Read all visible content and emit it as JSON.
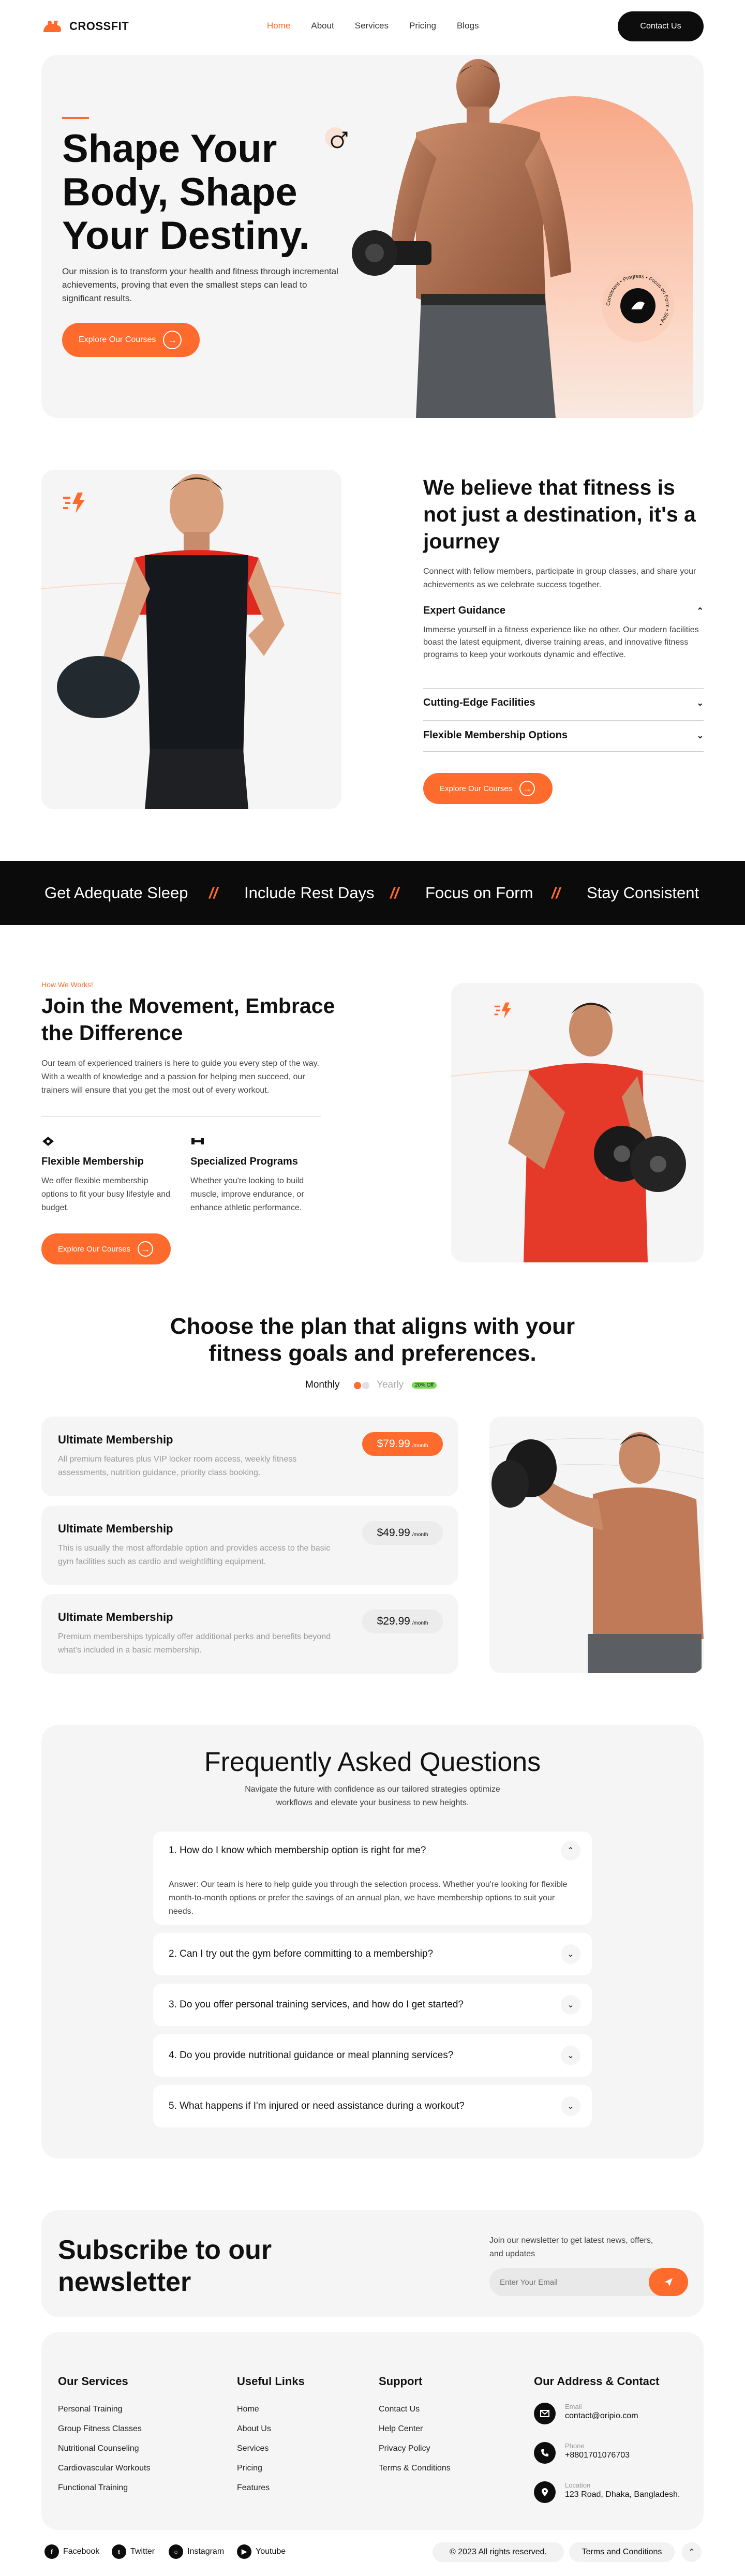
{
  "nav": {
    "brand": "CROSSFIT",
    "links": [
      "Home",
      "About",
      "Services",
      "Pricing",
      "Blogs"
    ],
    "contact_button": "Contact Us"
  },
  "hero": {
    "title": "Shape Your Body, Shape Your Destiny.",
    "description": "Our mission is to transform your health and fitness through incremental achievements, proving that even the smallest steps can lead to significant results.",
    "cta": "Explore Our Courses",
    "badge_text": "Consistent • Progress • Focus on Form • Stay •"
  },
  "about": {
    "title": "We believe that fitness is not just a destination, it's a journey",
    "subtitle": "Connect with fellow members, participate in group classes, and share your achievements as we celebrate success together.",
    "accordion": [
      {
        "title": "Expert Guidance",
        "body": "Immerse yourself in a fitness experience like no other. Our modern facilities boast the latest equipment, diverse training areas, and innovative fitness programs to keep your workouts dynamic and effective."
      },
      {
        "title": "Cutting-Edge Facilities",
        "body": ""
      },
      {
        "title": "Flexible Membership Options",
        "body": ""
      }
    ],
    "cta": "Explore Our Courses"
  },
  "banner": {
    "items": [
      "Get Adequate Sleep",
      "Include Rest Days",
      "Focus on Form",
      "Stay Consistent"
    ]
  },
  "join": {
    "eyebrow": "How We Works!",
    "title": "Join the Movement, Embrace the Difference",
    "description": "Our team of experienced trainers is here to guide you every step of the way. With a wealth of knowledge and a passion for helping men succeed, our trainers will ensure that you get the most out of every workout.",
    "features": [
      {
        "title": "Flexible Membership",
        "desc": "We offer flexible membership options to fit your busy lifestyle and budget."
      },
      {
        "title": "Specialized Programs",
        "desc": "Whether you're looking to build muscle, improve endurance, or enhance athletic performance."
      }
    ],
    "cta": "Explore Our Courses"
  },
  "plans": {
    "title": "Choose the plan that aligns with your fitness goals and preferences.",
    "toggle_monthly": "Monthly",
    "toggle_yearly": "Yearly",
    "yearly_badge": "20% Off",
    "items": [
      {
        "name": "Ultimate Membership",
        "desc": "All premium features plus VIP locker room access, weekly fitness assessments, nutrition guidance, priority class booking.",
        "price": "$79.99",
        "per": "/month",
        "highlight": true
      },
      {
        "name": "Ultimate Membership",
        "desc": "This is usually the most affordable option and provides access to the basic gym facilities such as cardio and weightlifting equipment.",
        "price": "$49.99",
        "per": "/month",
        "highlight": false
      },
      {
        "name": "Ultimate Membership",
        "desc": "Premium memberships typically offer additional perks and benefits beyond what's included in a basic membership.",
        "price": "$29.99",
        "per": "/month",
        "highlight": false
      }
    ]
  },
  "faq": {
    "title": "Frequently Asked Questions",
    "subtitle": "Navigate the future with confidence as our tailored strategies optimize workflows and elevate your business to new heights.",
    "items": [
      {
        "q": "1. How do I know which membership option is right for me?",
        "a": "Answer: Our team is here to help guide you through the selection process. Whether you're looking for flexible month-to-month options or prefer the savings of an annual plan, we have membership options to suit your needs."
      },
      {
        "q": "2. Can I try out the gym before committing to a membership?",
        "a": ""
      },
      {
        "q": "3. Do you offer personal training services, and how do I get started?",
        "a": ""
      },
      {
        "q": "4. Do you provide nutritional guidance or meal planning services?",
        "a": ""
      },
      {
        "q": "5. What happens if I'm injured or need assistance during a workout?",
        "a": ""
      }
    ]
  },
  "newsletter": {
    "title": "Subscribe to our newsletter",
    "subtitle": "Join our newsletter to get latest news, offers, and updates",
    "placeholder": "Enter Your Email"
  },
  "footer": {
    "services_title": "Our Services",
    "services": [
      "Personal Training",
      "Group Fitness Classes",
      "Nutritional Counseling",
      "Cardiovascular Workouts",
      "Functional Training"
    ],
    "links_title": "Useful Links",
    "links": [
      "Home",
      "About Us",
      "Services",
      "Pricing",
      "Features"
    ],
    "support_title": "Support",
    "support": [
      "Contact Us",
      "Help Center",
      "Privacy Policy",
      "Terms & Conditions"
    ],
    "address_title": "Our Address & Contact",
    "contacts": [
      {
        "label": "Email",
        "value": "contact@oripio.com"
      },
      {
        "label": "Phone",
        "value": "+8801701076703"
      },
      {
        "label": "Location",
        "value": "123 Road, Dhaka, Bangladesh."
      }
    ]
  },
  "bottom": {
    "socials": [
      "Facebook",
      "Twitter",
      "Instagram",
      "Youtube"
    ],
    "copyright": "© 2023 All rights reserved.",
    "terms": "Terms and Conditions"
  },
  "colors": {
    "accent": "#ff6b2c",
    "dark": "#0d0d0d",
    "panel": "#f5f5f5"
  }
}
